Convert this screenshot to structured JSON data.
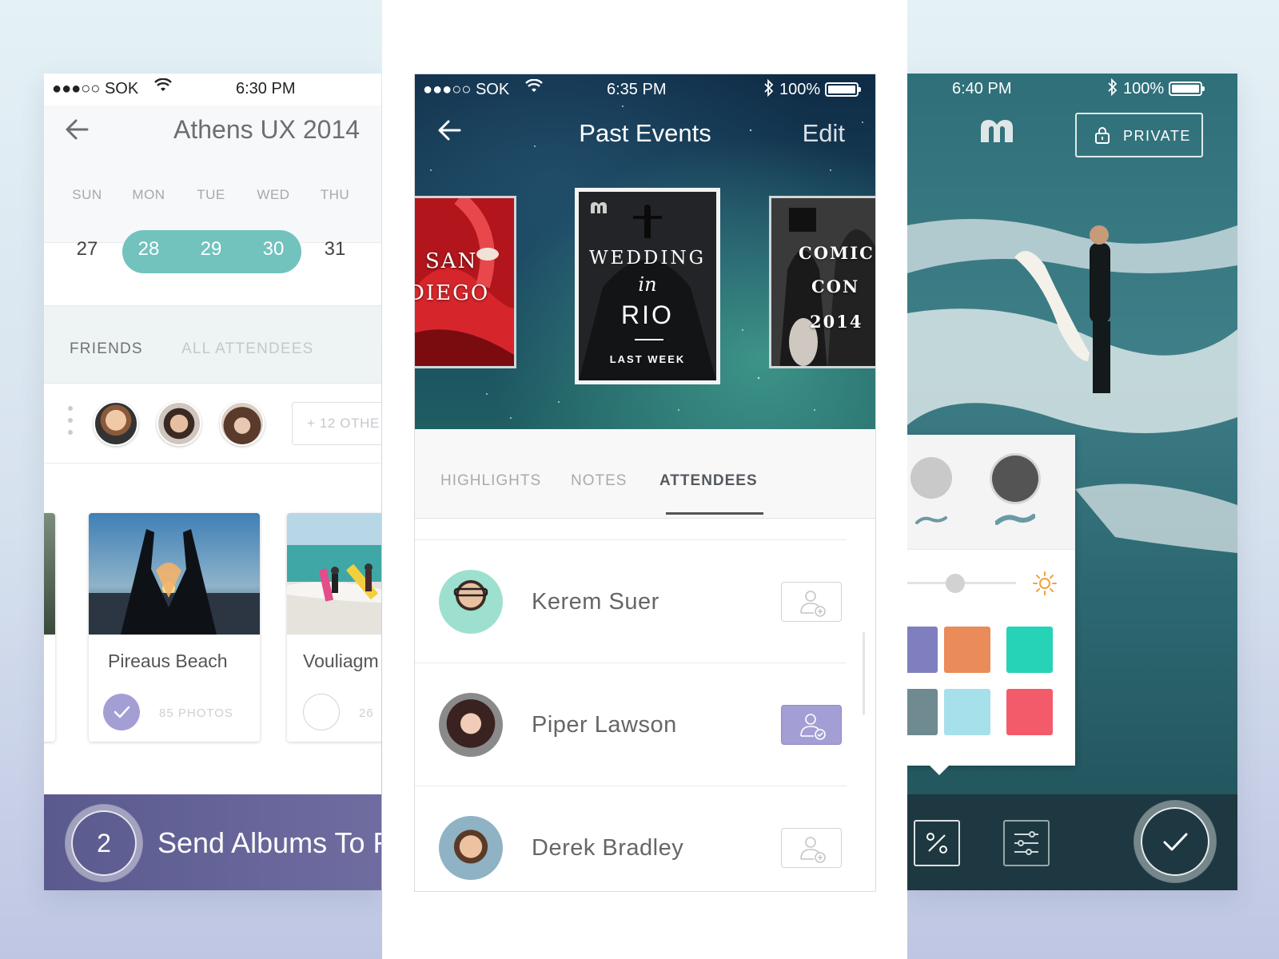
{
  "colors": {
    "teal_accent": "#72c2be",
    "purple_bar": "#5a5a8e",
    "selected_attendee": "#a39fd4",
    "swatches": [
      "#7f7fc0",
      "#ea8b5a",
      "#27d3b6",
      "#6f8a91",
      "#a6e0eb",
      "#f45b6a"
    ]
  },
  "left_phone": {
    "status": {
      "carrier": "●●●○○ SOK",
      "time": "6:30 PM"
    },
    "title": "Athens UX 2014",
    "calendar": {
      "day_names": [
        "SUN",
        "MON",
        "TUE",
        "WED",
        "THU"
      ],
      "day_numbers": [
        "27",
        "28",
        "29",
        "30",
        "31"
      ]
    },
    "tabs": {
      "friends": "FRIENDS",
      "all_attendees": "ALL ATTENDEES"
    },
    "others_button": "+ 12 OTHE",
    "albums": [
      {
        "name": "Pireaus Beach",
        "count": "85 PHOTOS",
        "selected": true
      },
      {
        "name": "Vouliagm",
        "count": "26",
        "selected": false
      }
    ],
    "send": {
      "count": "2",
      "label": "Send Albums To F"
    }
  },
  "middle_phone": {
    "status": {
      "carrier": "●●●○○ SOK",
      "time": "6:35 PM",
      "battery": "100%"
    },
    "title": "Past Events",
    "edit": "Edit",
    "cards": {
      "left": {
        "line1": "SAN",
        "line2": "DIEGO"
      },
      "center": {
        "line1": "WEDDING",
        "line2": "in",
        "line3": "RIO",
        "subtitle": "LAST WEEK"
      },
      "right": {
        "line1": "COMIC",
        "line2": "CON",
        "line3": "2014"
      }
    },
    "tabs": {
      "highlights": "HIGHLIGHTS",
      "notes": "NOTES",
      "attendees": "ATTENDEES"
    },
    "active_tab": "ATTENDEES",
    "attendees": [
      {
        "name": "Kerem Suer",
        "added": false
      },
      {
        "name": "Piper Lawson",
        "added": true
      },
      {
        "name": "Derek Bradley",
        "added": false
      }
    ]
  },
  "right_phone": {
    "status": {
      "time": "6:40 PM",
      "battery": "100%"
    },
    "private_button": "PRIVATE",
    "brush_sizes": [
      "light-gray",
      "dark-gray"
    ],
    "selected_brush": "dark-gray",
    "brightness_level": 0.45
  }
}
